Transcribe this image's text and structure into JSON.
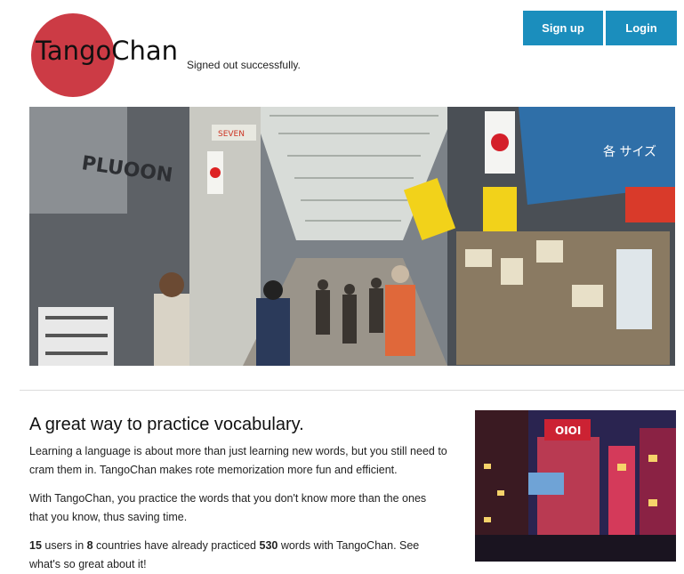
{
  "brand": {
    "logo_text": "TangoChan",
    "accent": "#cc3b45"
  },
  "flash": {
    "message": "Signed out successfully."
  },
  "nav": {
    "signup_label": "Sign up",
    "login_label": "Login",
    "button_color": "#1b8ebd"
  },
  "hero": {
    "sign_texts": [
      "PLUOON",
      "SEVEN",
      "各 サイズ"
    ]
  },
  "content": {
    "headline": "A great way to practice vocabulary.",
    "paragraph1": "Learning a language is about more than just learning new words, but you still need to cram them in. TangoChan makes rote memorization more fun and efficient.",
    "paragraph2": "With TangoChan, you practice the words that you don't know more than the ones that you know, thus saving time.",
    "stats": {
      "users": "15",
      "users_text": " users in ",
      "countries": "8",
      "countries_text": " countries have already practiced ",
      "words": "530",
      "words_text": " words with TangoChan. See what's so great about it!"
    }
  },
  "side_photo": {
    "sign_text": "OIOI"
  }
}
